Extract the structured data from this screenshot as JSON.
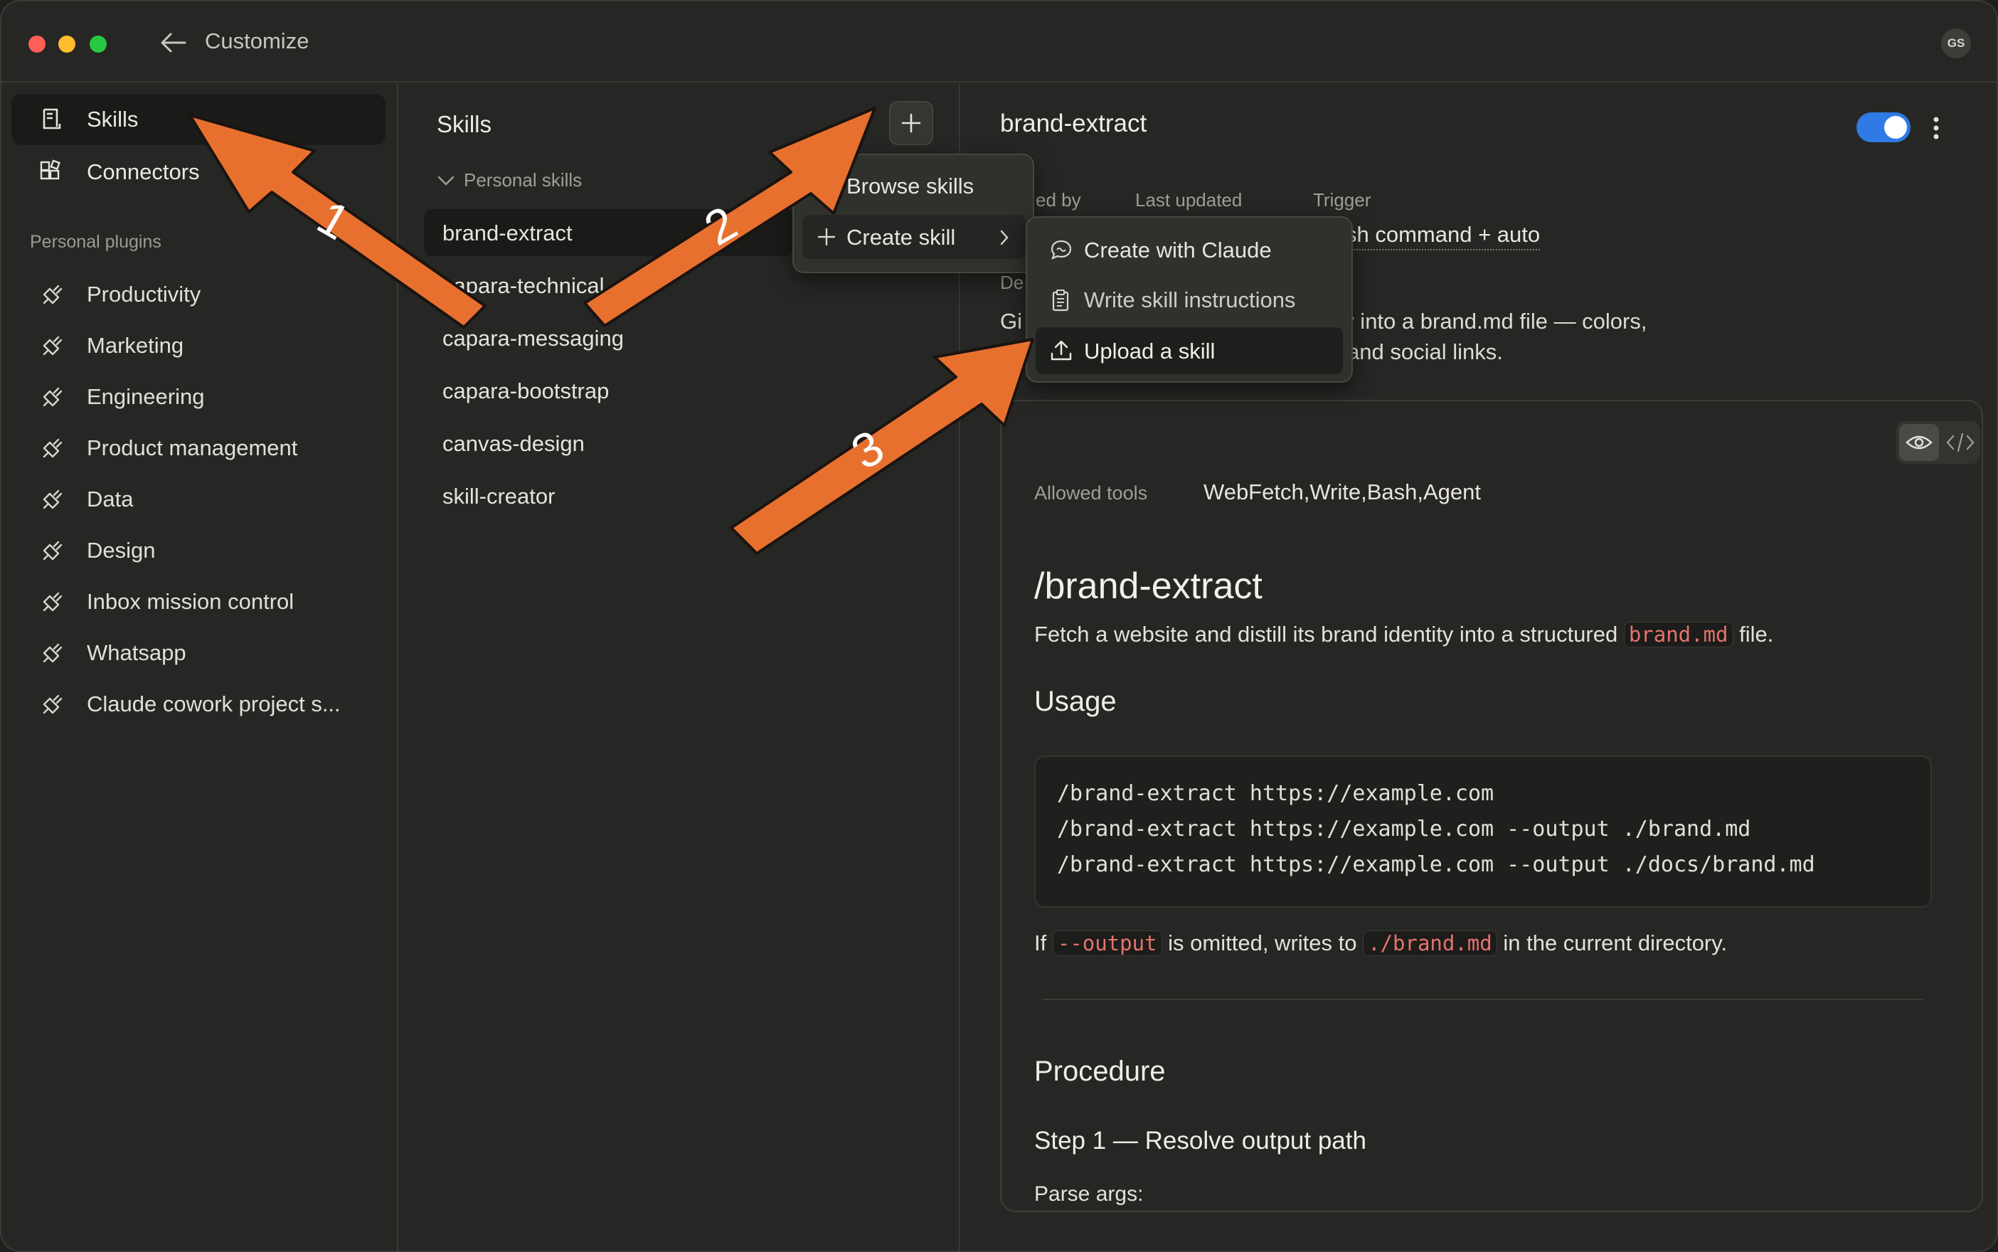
{
  "window": {
    "title": "Customize"
  },
  "user": {
    "initials": "GS"
  },
  "nav": {
    "items": [
      {
        "label": "Skills",
        "icon": "skills-icon"
      },
      {
        "label": "Connectors",
        "icon": "connectors-icon"
      }
    ],
    "section_label": "Personal plugins",
    "plugins": [
      "Productivity",
      "Marketing",
      "Engineering",
      "Product management",
      "Data",
      "Design",
      "Inbox mission control",
      "Whatsapp",
      "Claude cowork project s..."
    ]
  },
  "skills_panel": {
    "title": "Skills",
    "group_label": "Personal skills",
    "skills": [
      "brand-extract",
      "capara-technical",
      "capara-messaging",
      "capara-bootstrap",
      "canvas-design",
      "skill-creator"
    ]
  },
  "add_menu": {
    "items": [
      {
        "label": "Browse skills",
        "icon": "browse-icon"
      },
      {
        "label": "Create skill",
        "icon": "plus-icon"
      }
    ]
  },
  "create_submenu": {
    "items": [
      {
        "label": "Create with Claude",
        "icon": "chat-bubble-icon"
      },
      {
        "label": "Write skill instructions",
        "icon": "clipboard-icon"
      },
      {
        "label": "Upload a skill",
        "icon": "upload-icon"
      }
    ]
  },
  "detail": {
    "name": "brand-extract",
    "enabled": true,
    "meta": {
      "added_by_header": "ed by",
      "last_updated_header": "Last updated",
      "trigger_header": "Trigger",
      "trigger_value": "sh command + auto"
    },
    "description_header": "De",
    "description_start": "Gi",
    "description_line1": "ges and extract brand identity into a brand.md file — colors,",
    "description_line2": "and social links.",
    "allowed_tools_label": "Allowed tools",
    "allowed_tools_value": "WebFetch,Write,Bash,Agent",
    "heading": "/brand-extract",
    "intro_before": "Fetch a website and distill its brand identity into a structured",
    "intro_code": "brand.md",
    "intro_after": "file.",
    "usage_heading": "Usage",
    "usage_lines": [
      "/brand-extract https://example.com",
      "/brand-extract https://example.com --output ./brand.md",
      "/brand-extract https://example.com --output ./docs/brand.md"
    ],
    "note_if": "If",
    "note_code1": "--output",
    "note_mid": "is omitted, writes to",
    "note_code2": "./brand.md",
    "note_after": "in the current directory.",
    "procedure_heading": "Procedure",
    "step1_heading": "Step 1 — Resolve output path",
    "parse_args": "Parse args:"
  },
  "annotations": [
    "1",
    "2",
    "3"
  ],
  "colors": {
    "arrow": "#e8702f",
    "toggle": "#2f7ae5",
    "code_inline": "#e6736b"
  }
}
